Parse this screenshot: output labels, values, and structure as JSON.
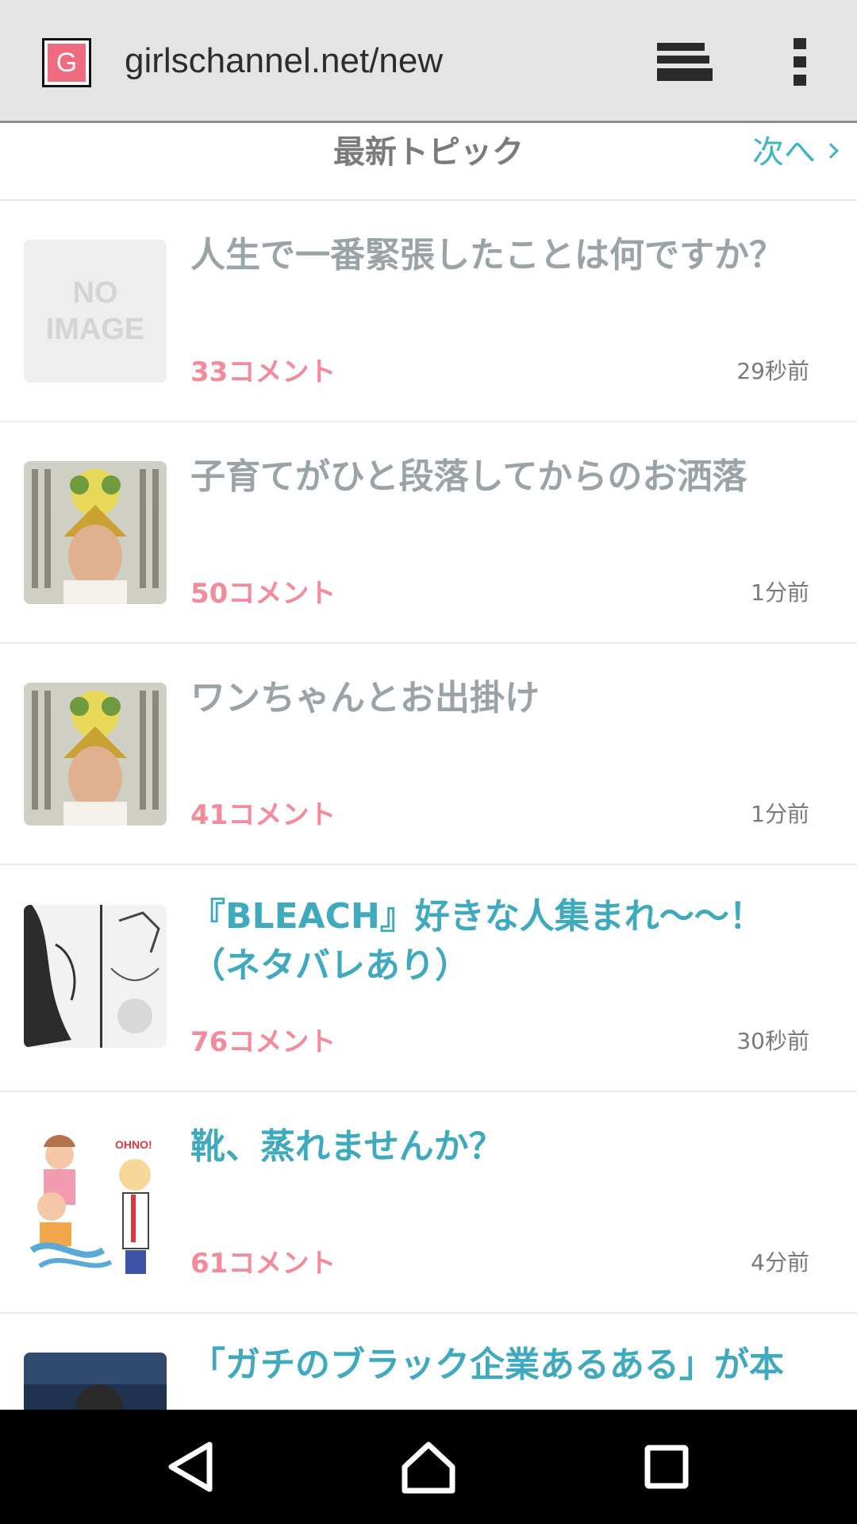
{
  "browser": {
    "url": "girlschannel.net/new",
    "favicon_letter": "G"
  },
  "header": {
    "title": "最新トピック",
    "next_label": "次へ"
  },
  "topics": [
    {
      "title": "人生で一番緊張したことは何ですか？",
      "comments": "33コメント",
      "time": "29秒前",
      "thumb": "no-image",
      "noimage_line1": "NO",
      "noimage_line2": "IMAGE"
    },
    {
      "title": "子育てがひと段落してからのお洒落",
      "comments": "50コメント",
      "time": "1分前",
      "thumb": "person-with-gold-crown-photo"
    },
    {
      "title": "ワンちゃんとお出掛け",
      "comments": "41コメント",
      "time": "1分前",
      "thumb": "person-with-gold-crown-photo"
    },
    {
      "title_line1": "『BLEACH』好きな人集まれ〜〜！",
      "title_line2": "（ネタバレあり）",
      "comments": "76コメント",
      "time": "30秒前",
      "thumb": "manga-panel"
    },
    {
      "title": "靴、蒸れませんか？",
      "comments": "61コメント",
      "time": "4分前",
      "thumb": "cartoon-illustration"
    },
    {
      "title": "「ガチのブラック企業あるある」が本",
      "thumb": "dark-photo"
    }
  ],
  "colors": {
    "teal": "#3fa9bd",
    "pink": "#f48a9a",
    "gray_title": "#9aa4a6"
  },
  "nav": [
    "back-icon",
    "home-icon",
    "recents-icon"
  ]
}
